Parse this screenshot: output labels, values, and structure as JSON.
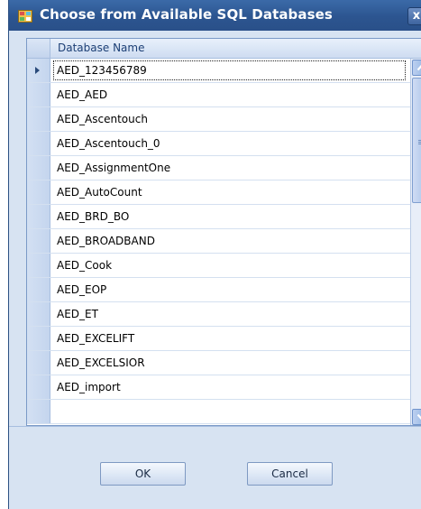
{
  "window": {
    "title": "Choose from Available SQL Databases",
    "close_label": "x"
  },
  "grid": {
    "column_header": "Database Name",
    "selected_index": 0,
    "rows": [
      "AED_123456789",
      "AED_AED",
      "AED_Ascentouch",
      "AED_Ascentouch_0",
      "AED_AssignmentOne",
      "AED_AutoCount",
      "AED_BRD_BO",
      "AED_BROADBAND",
      "AED_Cook",
      "AED_EOP",
      "AED_ET",
      "AED_EXCELIFT",
      "AED_EXCELSIOR",
      "AED_import",
      ""
    ],
    "scrollbar": {
      "position_fraction": 0.0,
      "visible_fraction": 0.38
    }
  },
  "footer": {
    "ok_label": "OK",
    "cancel_label": "Cancel"
  },
  "icons": {
    "app": "sql-database-window-icon",
    "close": "close-icon",
    "row_pointer": "current-row-arrow-icon",
    "scroll_up": "chevron-up-icon",
    "scroll_down": "chevron-down-icon"
  },
  "colors": {
    "titlebar": "#2c5590",
    "dialog_bg": "#d7e3f2",
    "grid_header_text": "#1c3f75"
  }
}
